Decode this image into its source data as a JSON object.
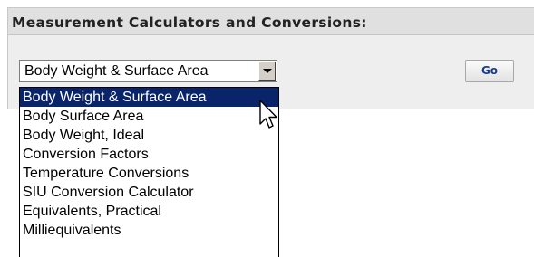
{
  "panel": {
    "title": "Measurement Calculators and Conversions:"
  },
  "calculator_select": {
    "selected_value": "Body Weight & Surface Area",
    "options": [
      "Body Weight & Surface Area",
      "Body Surface Area",
      "Body Weight, Ideal",
      "Conversion Factors",
      "Temperature Conversions",
      "SIU Conversion Calculator",
      "Equivalents, Practical",
      "Milliequivalents"
    ],
    "highlighted_index": 0
  },
  "go_button": {
    "label": "Go"
  },
  "colors": {
    "header_bg": "#e0e0e0",
    "panel_bg": "#eeeeee",
    "selection_bg": "#0a246a",
    "go_text": "#173c8c"
  },
  "icons": {
    "dropdown_arrow": "chevron-down-icon",
    "pointer": "mouse-pointer-icon"
  }
}
